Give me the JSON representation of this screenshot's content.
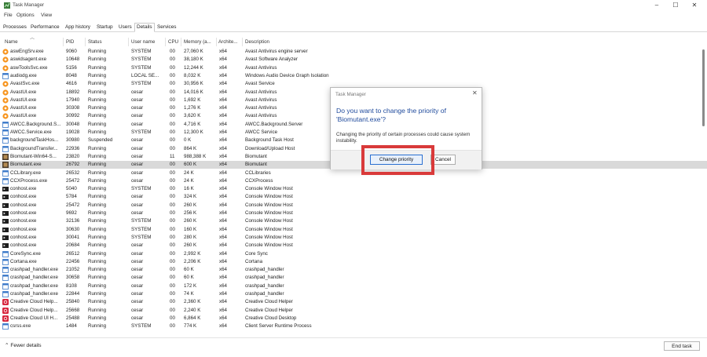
{
  "window": {
    "title": "Task Manager",
    "minimize": "–",
    "maximize": "☐",
    "close": "✕"
  },
  "menu": [
    "File",
    "Options",
    "View"
  ],
  "tabs": [
    "Processes",
    "Performance",
    "App history",
    "Startup",
    "Users",
    "Details",
    "Services"
  ],
  "active_tab": "Details",
  "columns": [
    "Name",
    "PID",
    "Status",
    "User name",
    "CPU",
    "Memory (a...",
    "Archite...",
    "Description"
  ],
  "rows": [
    {
      "name": "aswEngSrv.exe",
      "pid": "9060",
      "status": "Running",
      "user": "SYSTEM",
      "cpu": "00",
      "mem": "27,060 K",
      "arch": "x64",
      "desc": "Avast Antivirus engine server",
      "icon": "avast"
    },
    {
      "name": "aswidsagent.exe",
      "pid": "10648",
      "status": "Running",
      "user": "SYSTEM",
      "cpu": "00",
      "mem": "38,180 K",
      "arch": "x64",
      "desc": "Avast Software Analyzer",
      "icon": "avast"
    },
    {
      "name": "aswToolsSvc.exe",
      "pid": "5156",
      "status": "Running",
      "user": "SYSTEM",
      "cpu": "00",
      "mem": "12,244 K",
      "arch": "x64",
      "desc": "Avast Antivirus",
      "icon": "avast"
    },
    {
      "name": "audiodg.exe",
      "pid": "8048",
      "status": "Running",
      "user": "LOCAL SE...",
      "cpu": "00",
      "mem": "8,032 K",
      "arch": "x64",
      "desc": "Windows Audio Device Graph Isolation",
      "icon": "window"
    },
    {
      "name": "AvastSvc.exe",
      "pid": "4616",
      "status": "Running",
      "user": "SYSTEM",
      "cpu": "00",
      "mem": "30,956 K",
      "arch": "x64",
      "desc": "Avast Service",
      "icon": "avast"
    },
    {
      "name": "AvastUI.exe",
      "pid": "18892",
      "status": "Running",
      "user": "cesar",
      "cpu": "00",
      "mem": "14,016 K",
      "arch": "x64",
      "desc": "Avast Antivirus",
      "icon": "avast"
    },
    {
      "name": "AvastUI.exe",
      "pid": "17940",
      "status": "Running",
      "user": "cesar",
      "cpu": "00",
      "mem": "1,692 K",
      "arch": "x64",
      "desc": "Avast Antivirus",
      "icon": "avast"
    },
    {
      "name": "AvastUI.exe",
      "pid": "30308",
      "status": "Running",
      "user": "cesar",
      "cpu": "00",
      "mem": "1,276 K",
      "arch": "x64",
      "desc": "Avast Antivirus",
      "icon": "avast"
    },
    {
      "name": "AvastUI.exe",
      "pid": "30992",
      "status": "Running",
      "user": "cesar",
      "cpu": "00",
      "mem": "3,620 K",
      "arch": "x64",
      "desc": "Avast Antivirus",
      "icon": "avast"
    },
    {
      "name": "AWCC.Background.S...",
      "pid": "30048",
      "status": "Running",
      "user": "cesar",
      "cpu": "00",
      "mem": "4,716 K",
      "arch": "x64",
      "desc": "AWCC.Background.Server",
      "icon": "window"
    },
    {
      "name": "AWCC.Service.exe",
      "pid": "19028",
      "status": "Running",
      "user": "SYSTEM",
      "cpu": "00",
      "mem": "12,300 K",
      "arch": "x64",
      "desc": "AWCC Service",
      "icon": "window"
    },
    {
      "name": "backgroundTaskHos...",
      "pid": "30980",
      "status": "Suspended",
      "user": "cesar",
      "cpu": "00",
      "mem": "0 K",
      "arch": "x64",
      "desc": "Background Task Host",
      "icon": "window"
    },
    {
      "name": "BackgroundTransfer...",
      "pid": "22936",
      "status": "Running",
      "user": "cesar",
      "cpu": "00",
      "mem": "864 K",
      "arch": "x64",
      "desc": "Download/Upload Host",
      "icon": "window"
    },
    {
      "name": "Biomutant-Win64-S...",
      "pid": "23820",
      "status": "Running",
      "user": "cesar",
      "cpu": "11",
      "mem": "988,388 K",
      "arch": "x64",
      "desc": "Biomutant",
      "icon": "game"
    },
    {
      "name": "Biomutant.exe",
      "pid": "26792",
      "status": "Running",
      "user": "cesar",
      "cpu": "00",
      "mem": "600 K",
      "arch": "x64",
      "desc": "Biomutant",
      "icon": "game",
      "selected": true
    },
    {
      "name": "CCLibrary.exe",
      "pid": "26532",
      "status": "Running",
      "user": "cesar",
      "cpu": "00",
      "mem": "24 K",
      "arch": "x64",
      "desc": "CCLibraries",
      "icon": "window"
    },
    {
      "name": "CCXProcess.exe",
      "pid": "25472",
      "status": "Running",
      "user": "cesar",
      "cpu": "00",
      "mem": "24 K",
      "arch": "x64",
      "desc": "CCXProcess",
      "icon": "window"
    },
    {
      "name": "conhost.exe",
      "pid": "5040",
      "status": "Running",
      "user": "SYSTEM",
      "cpu": "00",
      "mem": "16 K",
      "arch": "x64",
      "desc": "Console Window Host",
      "icon": "console"
    },
    {
      "name": "conhost.exe",
      "pid": "5784",
      "status": "Running",
      "user": "cesar",
      "cpu": "00",
      "mem": "324 K",
      "arch": "x64",
      "desc": "Console Window Host",
      "icon": "console"
    },
    {
      "name": "conhost.exe",
      "pid": "25472",
      "status": "Running",
      "user": "cesar",
      "cpu": "00",
      "mem": "260 K",
      "arch": "x64",
      "desc": "Console Window Host",
      "icon": "console"
    },
    {
      "name": "conhost.exe",
      "pid": "9692",
      "status": "Running",
      "user": "cesar",
      "cpu": "00",
      "mem": "256 K",
      "arch": "x64",
      "desc": "Console Window Host",
      "icon": "console"
    },
    {
      "name": "conhost.exe",
      "pid": "32136",
      "status": "Running",
      "user": "SYSTEM",
      "cpu": "00",
      "mem": "260 K",
      "arch": "x64",
      "desc": "Console Window Host",
      "icon": "console"
    },
    {
      "name": "conhost.exe",
      "pid": "30630",
      "status": "Running",
      "user": "SYSTEM",
      "cpu": "00",
      "mem": "160 K",
      "arch": "x64",
      "desc": "Console Window Host",
      "icon": "console"
    },
    {
      "name": "conhost.exe",
      "pid": "30041",
      "status": "Running",
      "user": "SYSTEM",
      "cpu": "00",
      "mem": "280 K",
      "arch": "x64",
      "desc": "Console Window Host",
      "icon": "console"
    },
    {
      "name": "conhost.exe",
      "pid": "20684",
      "status": "Running",
      "user": "cesar",
      "cpu": "00",
      "mem": "260 K",
      "arch": "x64",
      "desc": "Console Window Host",
      "icon": "console"
    },
    {
      "name": "CoreSync.exe",
      "pid": "26512",
      "status": "Running",
      "user": "cesar",
      "cpu": "00",
      "mem": "2,992 K",
      "arch": "x64",
      "desc": "Core Sync",
      "icon": "window"
    },
    {
      "name": "Cortana.exe",
      "pid": "22456",
      "status": "Running",
      "user": "cesar",
      "cpu": "00",
      "mem": "2,206 K",
      "arch": "x64",
      "desc": "Cortana",
      "icon": "window"
    },
    {
      "name": "crashpad_handler.exe",
      "pid": "21052",
      "status": "Running",
      "user": "cesar",
      "cpu": "00",
      "mem": "60 K",
      "arch": "x64",
      "desc": "crashpad_handler",
      "icon": "window"
    },
    {
      "name": "crashpad_handler.exe",
      "pid": "30658",
      "status": "Running",
      "user": "cesar",
      "cpu": "00",
      "mem": "60 K",
      "arch": "x64",
      "desc": "crashpad_handler",
      "icon": "window"
    },
    {
      "name": "crashpad_handler.exe",
      "pid": "8108",
      "status": "Running",
      "user": "cesar",
      "cpu": "00",
      "mem": "172 K",
      "arch": "x64",
      "desc": "crashpad_handler",
      "icon": "window"
    },
    {
      "name": "crashpad_handler.exe",
      "pid": "22844",
      "status": "Running",
      "user": "cesar",
      "cpu": "00",
      "mem": "74 K",
      "arch": "x64",
      "desc": "crashpad_handler",
      "icon": "window"
    },
    {
      "name": "Creative Cloud Help...",
      "pid": "25840",
      "status": "Running",
      "user": "cesar",
      "cpu": "00",
      "mem": "2,360 K",
      "arch": "x64",
      "desc": "Creative Cloud Helper",
      "icon": "cc"
    },
    {
      "name": "Creative Cloud Help...",
      "pid": "25668",
      "status": "Running",
      "user": "cesar",
      "cpu": "00",
      "mem": "2,240 K",
      "arch": "x64",
      "desc": "Creative Cloud Helper",
      "icon": "cc"
    },
    {
      "name": "Creative Cloud UI H...",
      "pid": "25488",
      "status": "Running",
      "user": "cesar",
      "cpu": "00",
      "mem": "6,864 K",
      "arch": "x64",
      "desc": "Creative Cloud Desktop",
      "icon": "cc"
    },
    {
      "name": "csrss.exe",
      "pid": "1484",
      "status": "Running",
      "user": "SYSTEM",
      "cpu": "00",
      "mem": "774 K",
      "arch": "x64",
      "desc": "Client Server Runtime Process",
      "icon": "window"
    }
  ],
  "footer": {
    "fewer_details": "Fewer details",
    "end_task": "End task"
  },
  "dialog": {
    "title": "Task Manager",
    "close": "✕",
    "heading": "Do you want to change the priority of 'Biomutant.exe'?",
    "body": "Changing the priority of certain processes could cause system instability.",
    "confirm": "Change priority",
    "cancel": "Cancel"
  },
  "colors": {
    "accent": "#1f4a9c",
    "highlight": "#d93a3a",
    "avast": "#f7941d",
    "cc": "#d7263d",
    "selected_row": "#d9d9d9"
  }
}
